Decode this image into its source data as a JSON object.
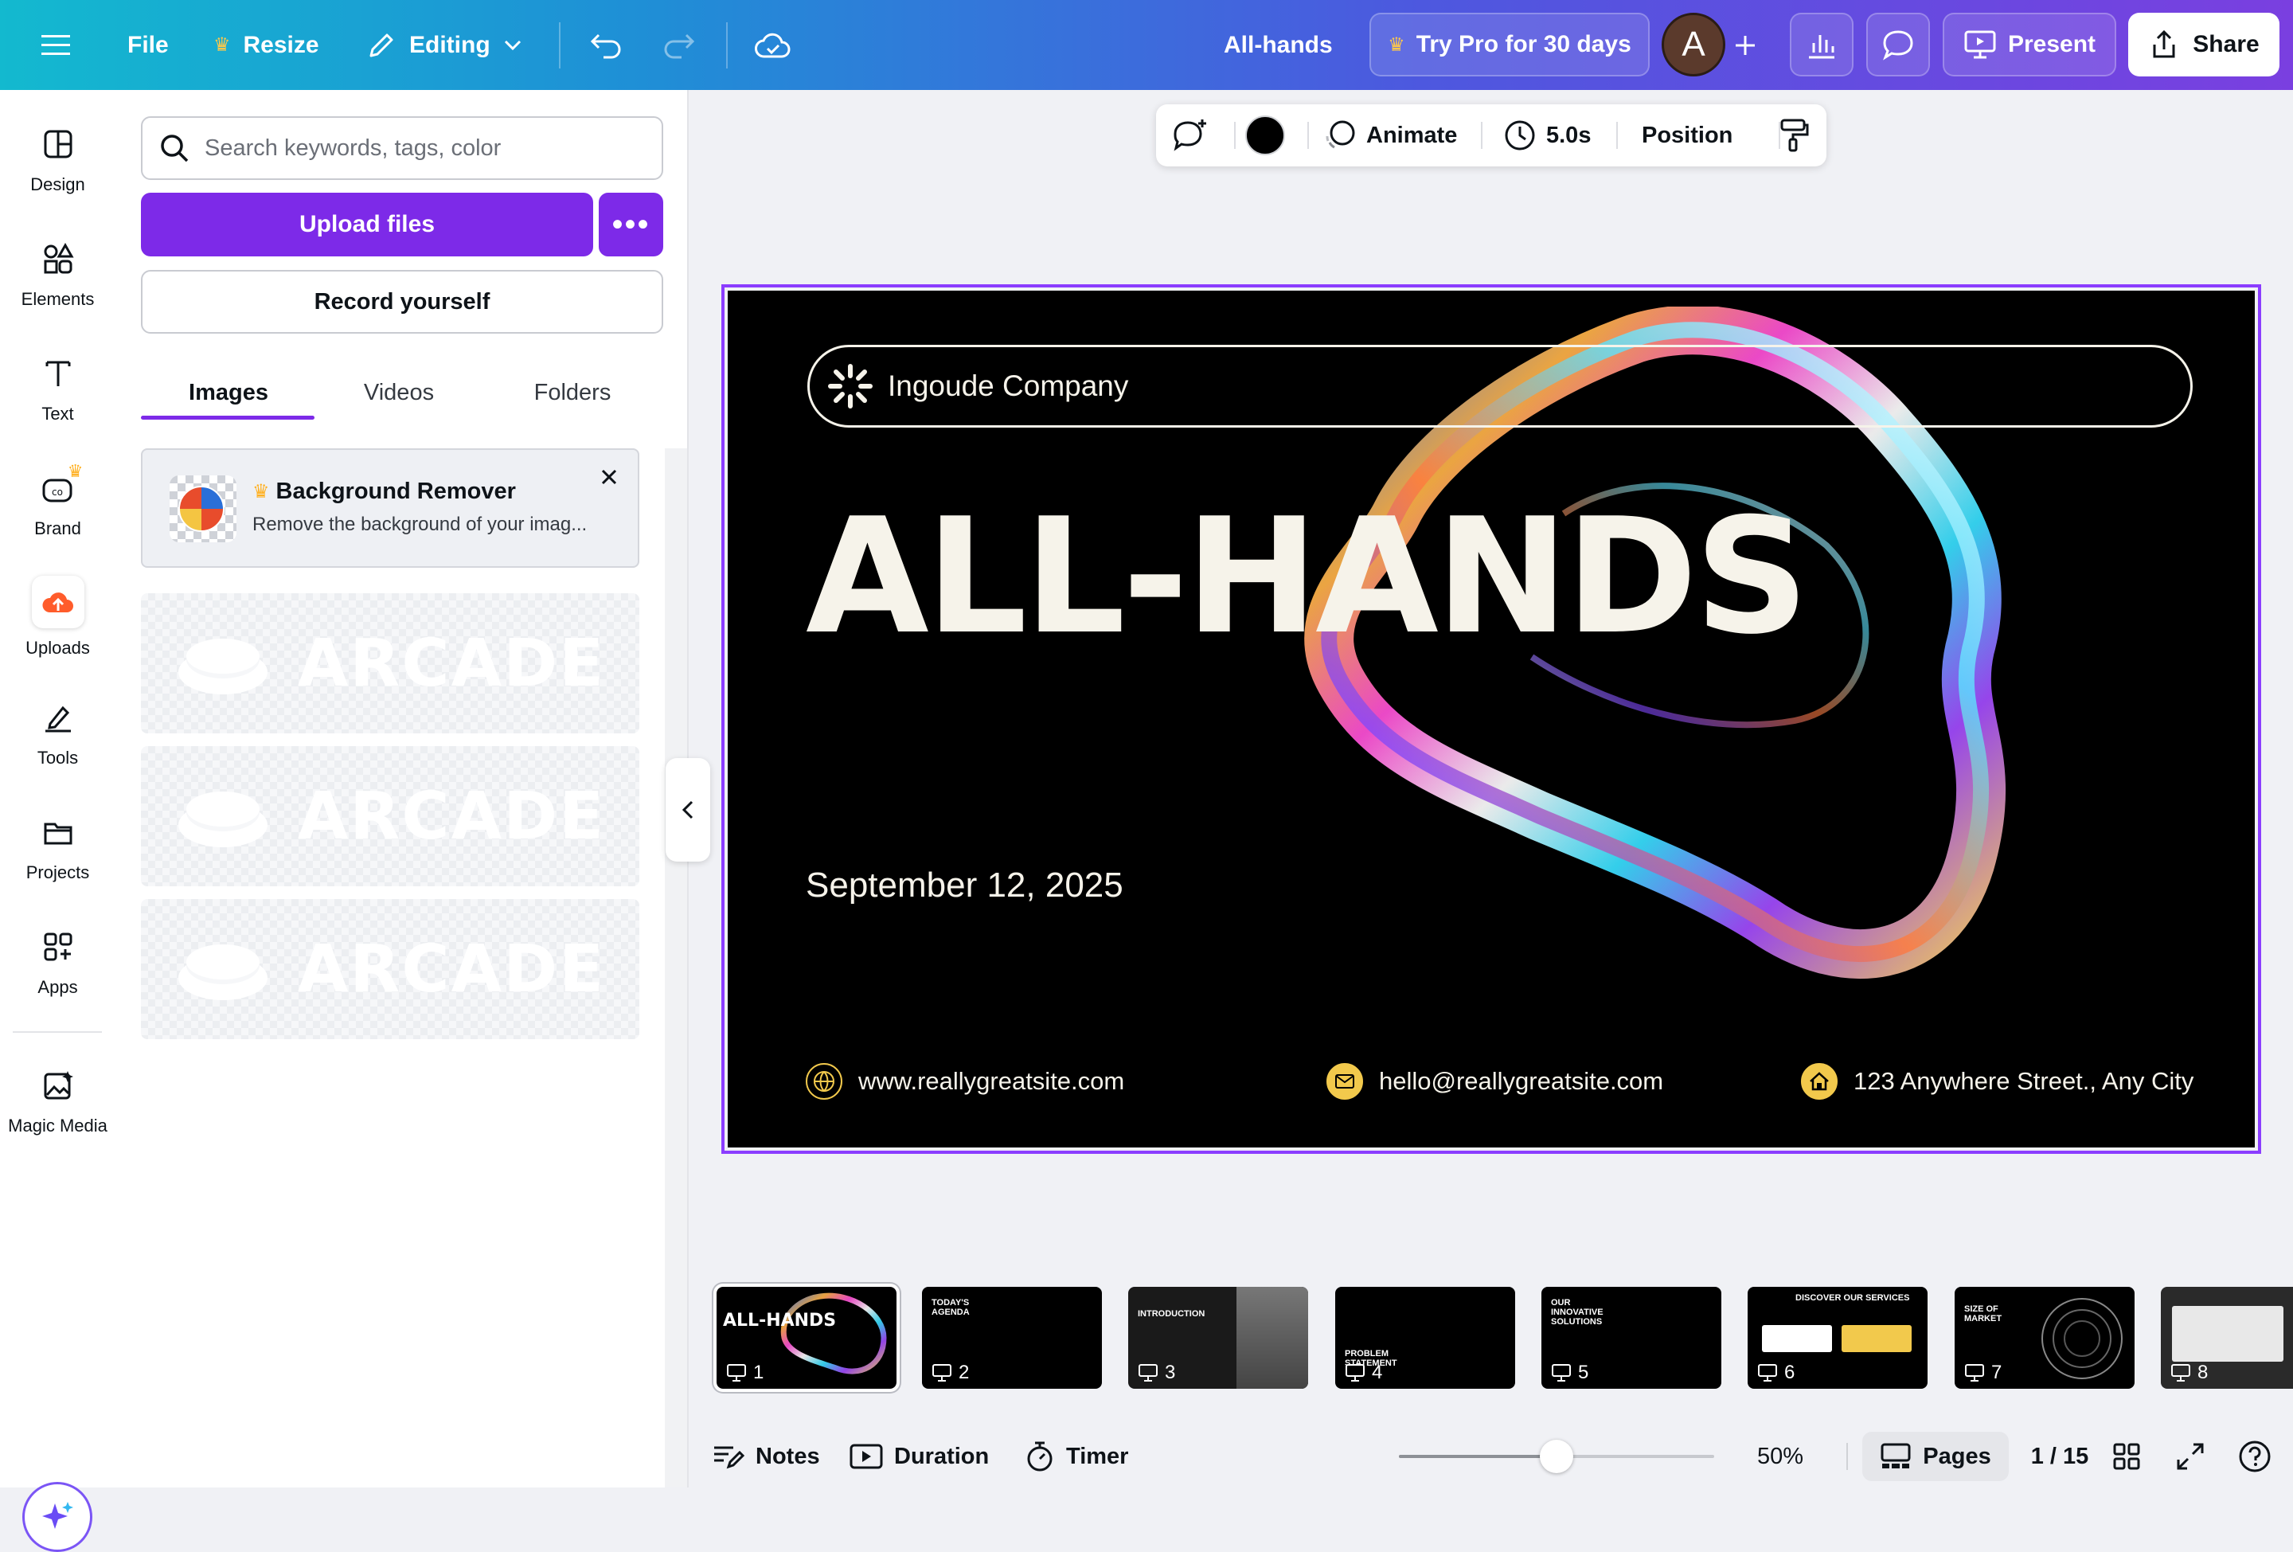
{
  "topbar": {
    "file_label": "File",
    "resize_label": "Resize",
    "editing_label": "Editing",
    "doc_title": "All-hands",
    "try_pro_label": "Try Pro for 30 days",
    "avatar_initial": "A",
    "present_label": "Present",
    "share_label": "Share"
  },
  "rail": {
    "items": [
      {
        "label": "Design"
      },
      {
        "label": "Elements"
      },
      {
        "label": "Text"
      },
      {
        "label": "Brand"
      },
      {
        "label": "Uploads"
      },
      {
        "label": "Tools"
      },
      {
        "label": "Projects"
      },
      {
        "label": "Apps"
      },
      {
        "label": "Magic Media"
      }
    ]
  },
  "panel": {
    "search_placeholder": "Search keywords, tags, color",
    "upload_label": "Upload files",
    "more_label": "•••",
    "record_label": "Record yourself",
    "tabs": [
      {
        "label": "Images"
      },
      {
        "label": "Videos"
      },
      {
        "label": "Folders"
      }
    ],
    "promo": {
      "title": "Background Remover",
      "description": "Remove the background of your imag..."
    },
    "uploads": [
      {
        "text": "ARCADE"
      },
      {
        "text": "ARCADE"
      },
      {
        "text": "ARCADE"
      }
    ]
  },
  "context_toolbar": {
    "animate_label": "Animate",
    "duration_label": "5.0s",
    "position_label": "Position",
    "color_swatch": "#000000"
  },
  "slide": {
    "company": "Ingoude Company",
    "title": "ALL-HANDS",
    "date": "September 12, 2025",
    "website": "www.reallygreatsite.com",
    "email": "hello@reallygreatsite.com",
    "address": "123 Anywhere Street., Any City",
    "accent_color": "#f2c94c",
    "text_color": "#f6f3ea"
  },
  "thumbnails": [
    {
      "num": "1",
      "heading": "ALL-HANDS"
    },
    {
      "num": "2",
      "heading": "TODAY'S AGENDA"
    },
    {
      "num": "3",
      "heading": "INTRODUCTION"
    },
    {
      "num": "4",
      "heading": "PROBLEM STATEMENT"
    },
    {
      "num": "5",
      "heading": "OUR INNOVATIVE SOLUTIONS"
    },
    {
      "num": "6",
      "heading": "DISCOVER OUR SERVICES"
    },
    {
      "num": "7",
      "heading": "SIZE OF MARKET"
    },
    {
      "num": "8",
      "heading": ""
    }
  ],
  "bottombar": {
    "notes_label": "Notes",
    "duration_label": "Duration",
    "timer_label": "Timer",
    "zoom_label": "50%",
    "zoom_fraction": 0.5,
    "pages_label": "Pages",
    "page_counter": "1 / 15"
  },
  "colors": {
    "accent_purple": "#7d2ae8",
    "selection_purple": "#8b3dff"
  }
}
